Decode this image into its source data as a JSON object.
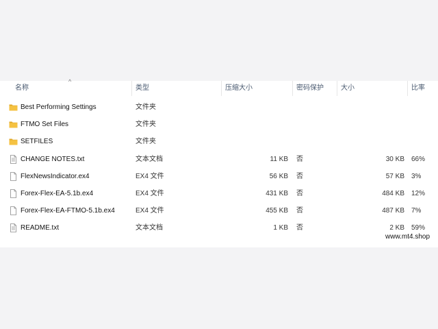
{
  "columns": {
    "name": "名称",
    "type": "类型",
    "packed": "压缩大小",
    "encrypted": "密码保护",
    "size": "大小",
    "ratio": "比率"
  },
  "rows": [
    {
      "name": "Best Performing Settings",
      "type": "文件夹",
      "packed": "",
      "encrypted": "",
      "size": "",
      "ratio": "",
      "icon": "folder-icon"
    },
    {
      "name": "FTMO Set Files",
      "type": "文件夹",
      "packed": "",
      "encrypted": "",
      "size": "",
      "ratio": "",
      "icon": "folder-icon"
    },
    {
      "name": "SETFILES",
      "type": "文件夹",
      "packed": "",
      "encrypted": "",
      "size": "",
      "ratio": "",
      "icon": "folder-icon"
    },
    {
      "name": "CHANGE NOTES.txt",
      "type": "文本文档",
      "packed": "11 KB",
      "encrypted": "否",
      "size": "30 KB",
      "ratio": "66%",
      "icon": "text-file-icon"
    },
    {
      "name": "FlexNewsIndicator.ex4",
      "type": "EX4 文件",
      "packed": "56 KB",
      "encrypted": "否",
      "size": "57 KB",
      "ratio": "3%",
      "icon": "file-icon"
    },
    {
      "name": "Forex-Flex-EA-5.1b.ex4",
      "type": "EX4 文件",
      "packed": "431 KB",
      "encrypted": "否",
      "size": "484 KB",
      "ratio": "12%",
      "icon": "file-icon"
    },
    {
      "name": "Forex-Flex-EA-FTMO-5.1b.ex4",
      "type": "EX4 文件",
      "packed": "455 KB",
      "encrypted": "否",
      "size": "487 KB",
      "ratio": "7%",
      "icon": "file-icon"
    },
    {
      "name": "README.txt",
      "type": "文本文档",
      "packed": "1 KB",
      "encrypted": "否",
      "size": "2 KB",
      "ratio": "59%",
      "icon": "text-file-icon"
    }
  ],
  "watermark": "www.mt4.shop",
  "colors": {
    "folder": "#f5c242",
    "folder_dark": "#e0a82a",
    "file_border": "#8a8a8a",
    "header_text": "#4a5a70"
  }
}
